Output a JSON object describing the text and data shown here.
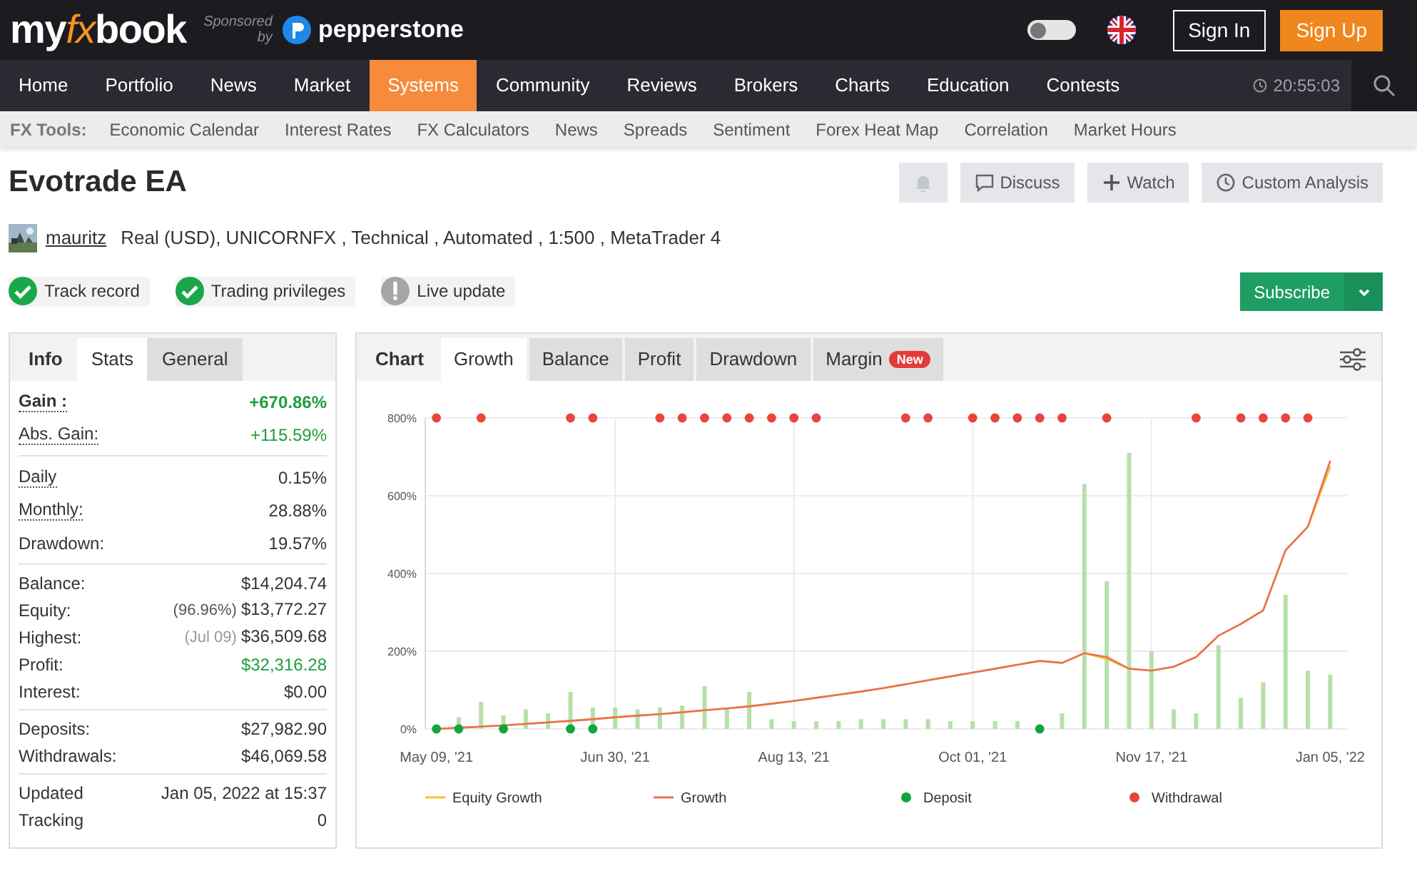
{
  "header": {
    "logo": [
      {
        "text": "my",
        "accent": false
      },
      {
        "text": "fx",
        "accent": true
      },
      {
        "text": "book",
        "accent": false
      }
    ],
    "sponsor_lines": [
      "Sponsored",
      "by"
    ],
    "sponsor_name": "pepperstone",
    "theme_toggle": {
      "on": false
    },
    "buttons": [
      {
        "label": "Sign In",
        "kind": "outline"
      },
      {
        "label": "Sign Up",
        "kind": "primary"
      }
    ]
  },
  "nav": {
    "items": [
      {
        "label": "Home",
        "selected": false
      },
      {
        "label": "Portfolio",
        "selected": false
      },
      {
        "label": "News",
        "selected": false
      },
      {
        "label": "Market",
        "selected": false
      },
      {
        "label": "Systems",
        "selected": true
      },
      {
        "label": "Community",
        "selected": false
      },
      {
        "label": "Reviews",
        "selected": false
      },
      {
        "label": "Brokers",
        "selected": false
      },
      {
        "label": "Charts",
        "selected": false
      },
      {
        "label": "Education",
        "selected": false
      },
      {
        "label": "Contests",
        "selected": false
      }
    ],
    "time": "20:55:03"
  },
  "tools": {
    "label": "FX Tools:",
    "items": [
      "Economic Calendar",
      "Interest Rates",
      "FX Calculators",
      "News",
      "Spreads",
      "Sentiment",
      "Forex Heat Map",
      "Correlation",
      "Market Hours"
    ]
  },
  "system": {
    "title": "Evotrade EA",
    "actions": [
      {
        "kind": "bell"
      },
      {
        "kind": "discuss",
        "label": "Discuss"
      },
      {
        "kind": "watch",
        "label": "Watch"
      },
      {
        "kind": "analysis",
        "label": "Custom Analysis"
      }
    ],
    "owner": "mauritz",
    "details": "Real (USD), UNICORNFX , Technical , Automated , 1:500 , MetaTrader 4",
    "badges": [
      {
        "label": "Track record",
        "kind": "ok"
      },
      {
        "label": "Trading privileges",
        "kind": "ok"
      },
      {
        "label": "Live update",
        "kind": "warning"
      }
    ],
    "subscribe": "Subscribe"
  },
  "stats_panel": {
    "tabs": [
      {
        "label": "Info",
        "selected": false
      },
      {
        "label": "Stats",
        "selected": true
      },
      {
        "label": "General",
        "selected": false
      }
    ],
    "groups": [
      [
        {
          "label": "Gain :",
          "value": "+670.86%",
          "bold": true,
          "hint": true,
          "positive": true
        },
        {
          "label": "Abs. Gain:",
          "value": "+115.59%",
          "bold": false,
          "hint": true,
          "positive": true
        }
      ],
      [
        {
          "label": "Daily",
          "value": "0.15%",
          "bold": false,
          "hint": true,
          "positive": false
        },
        {
          "label": "Monthly:",
          "value": "28.88%",
          "bold": false,
          "hint": true,
          "positive": false
        },
        {
          "label": "Drawdown:",
          "value": "19.57%",
          "bold": false,
          "hint": false,
          "positive": false
        }
      ],
      [
        {
          "label": "Balance:",
          "value": "$14,204.74",
          "bold": false,
          "hint": false,
          "positive": false
        },
        {
          "label": "Equity:",
          "note": "(96.96%)",
          "value": "$13,772.27",
          "bold": false,
          "hint": false,
          "positive": false
        },
        {
          "label": "Highest:",
          "note": "(Jul 09)",
          "value": "$36,509.68",
          "bold": false,
          "hint": false,
          "positive": false
        },
        {
          "label": "Profit:",
          "value": "$32,316.28",
          "bold": false,
          "hint": false,
          "positive": true
        },
        {
          "label": "Interest:",
          "value": "$0.00",
          "bold": false,
          "hint": false,
          "positive": false
        }
      ],
      [
        {
          "label": "Deposits:",
          "value": "$27,982.90",
          "bold": false,
          "hint": false,
          "positive": false
        },
        {
          "label": "Withdrawals:",
          "value": "$46,069.58",
          "bold": false,
          "hint": false,
          "positive": false
        }
      ],
      [
        {
          "label": "Updated",
          "value": "Jan 05, 2022 at 15:37",
          "bold": false,
          "hint": false,
          "positive": false
        },
        {
          "label": "Tracking",
          "value": "0",
          "bold": false,
          "hint": false,
          "positive": false
        }
      ]
    ]
  },
  "chart_panel": {
    "heading": "Chart",
    "tabs": [
      {
        "label": "Growth",
        "selected": true
      },
      {
        "label": "Balance",
        "selected": false
      },
      {
        "label": "Profit",
        "selected": false
      },
      {
        "label": "Drawdown",
        "selected": false
      },
      {
        "label": "Margin",
        "selected": false,
        "badge": "New"
      }
    ],
    "chart_data": {
      "type": "line",
      "ylim": [
        0,
        800
      ],
      "grid": true,
      "legend": true,
      "categories": [
        "May 09, '21",
        null,
        null,
        null,
        null,
        null,
        null,
        null,
        "Jun 30, '21",
        null,
        null,
        null,
        null,
        null,
        null,
        null,
        "Aug 13, '21",
        null,
        null,
        null,
        null,
        null,
        null,
        null,
        "Oct 01, '21",
        null,
        null,
        null,
        null,
        null,
        null,
        null,
        "Nov 17, '21",
        null,
        null,
        null,
        null,
        null,
        null,
        null,
        "Jan 05, '22"
      ],
      "yticks": [
        {
          "value": 0,
          "label": "0%"
        },
        {
          "value": 200,
          "label": "200%"
        },
        {
          "value": 400,
          "label": "400%"
        },
        {
          "value": 600,
          "label": "600%"
        },
        {
          "value": 800,
          "label": "800%"
        }
      ],
      "series": [
        {
          "type": "bar",
          "color": "#b7dfaa",
          "values": [
            null,
            30,
            70,
            35,
            50,
            40,
            95,
            55,
            55,
            50,
            55,
            60,
            110,
            55,
            95,
            25,
            20,
            20,
            20,
            25,
            25,
            25,
            25,
            20,
            20,
            20,
            20,
            null,
            40,
            630,
            380,
            710,
            200,
            50,
            40,
            215,
            80,
            120,
            345,
            150,
            140
          ]
        },
        {
          "name": "Equity Growth",
          "type": "line",
          "color": "#f3c13a",
          "values": [
            0,
            3,
            6,
            9,
            13,
            17,
            21,
            25,
            30,
            34,
            38,
            43,
            48,
            53,
            58,
            65,
            72,
            80,
            88,
            96,
            105,
            115,
            125,
            135,
            145,
            155,
            165,
            175,
            170,
            195,
            180,
            155,
            150,
            160,
            185,
            240,
            270,
            305,
            460,
            520,
            675
          ]
        },
        {
          "name": "Growth",
          "type": "line",
          "color": "#e8714f",
          "values": [
            0,
            3,
            6,
            9,
            13,
            17,
            21,
            25,
            30,
            34,
            38,
            43,
            48,
            53,
            58,
            65,
            72,
            80,
            88,
            96,
            105,
            115,
            125,
            135,
            145,
            155,
            165,
            175,
            170,
            195,
            185,
            155,
            150,
            160,
            185,
            240,
            270,
            305,
            460,
            520,
            690
          ]
        },
        {
          "name": "Deposit",
          "type": "scatter",
          "color": "#12a53c",
          "values": [
            0,
            0,
            null,
            0,
            null,
            null,
            0,
            0,
            null,
            null,
            null,
            null,
            null,
            null,
            null,
            null,
            null,
            null,
            null,
            null,
            null,
            null,
            null,
            null,
            null,
            null,
            null,
            0,
            null,
            null,
            null,
            null,
            null,
            null,
            null,
            null,
            null,
            null,
            null,
            null,
            null
          ]
        },
        {
          "name": "Withdrawal",
          "type": "scatter",
          "color": "#e8453c",
          "values": [
            800,
            null,
            800,
            null,
            null,
            null,
            800,
            800,
            null,
            null,
            800,
            800,
            800,
            800,
            800,
            800,
            800,
            800,
            null,
            null,
            null,
            800,
            800,
            null,
            800,
            800,
            800,
            800,
            800,
            null,
            800,
            null,
            null,
            null,
            800,
            null,
            800,
            800,
            800,
            800,
            null
          ]
        }
      ]
    }
  }
}
